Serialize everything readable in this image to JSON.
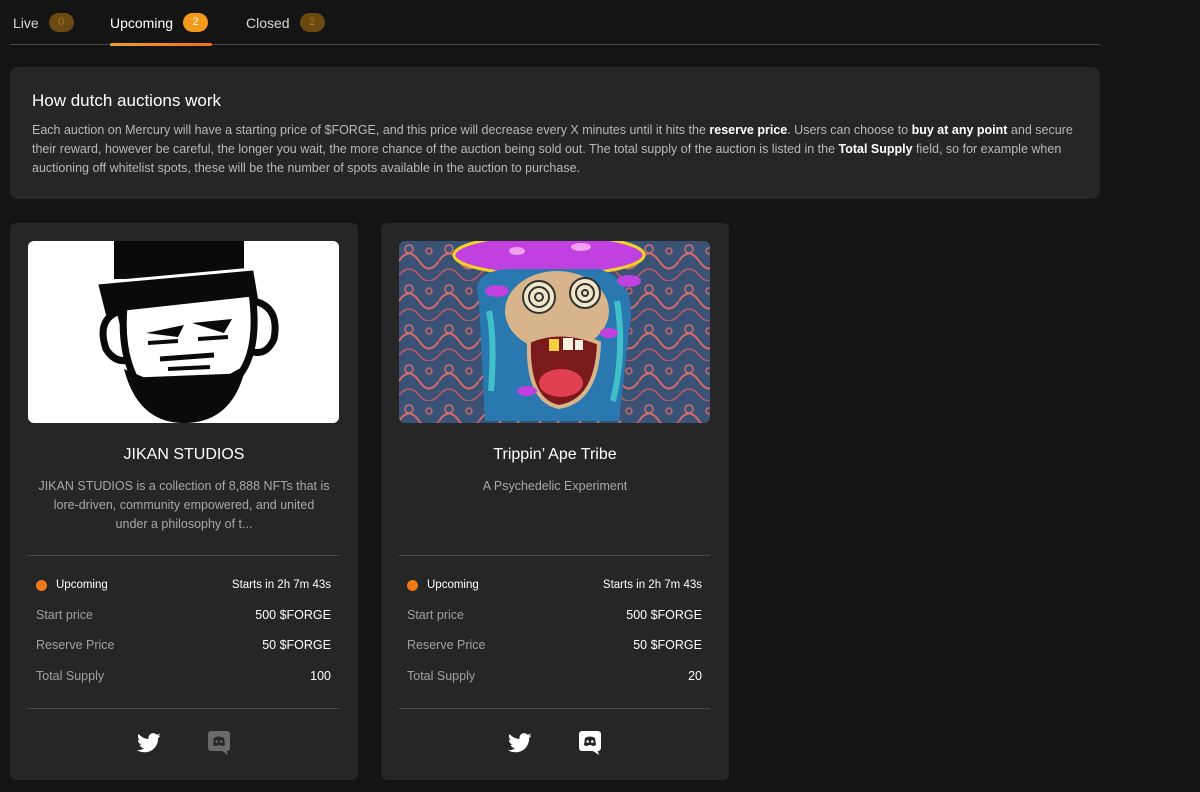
{
  "tabs": [
    {
      "label": "Live",
      "count": "0"
    },
    {
      "label": "Upcoming",
      "count": "2"
    },
    {
      "label": "Closed",
      "count": "2"
    }
  ],
  "info": {
    "title": "How dutch auctions work",
    "text_1": "Each auction on Mercury will have a starting price of $FORGE, and this price will decrease every X minutes until it hits the ",
    "bold_1": "reserve price",
    "text_2": ". Users can choose to ",
    "bold_2": "buy at any point",
    "text_3": " and secure their reward, however be careful, the longer you wait, the more chance of the auction being sold out. The total supply of the auction is listed in the ",
    "bold_3": "Total Supply",
    "text_4": " field, so for example when auctioning off whitelist spots, these will be the number of spots available in the auction to purchase."
  },
  "cards": [
    {
      "title": "JIKAN STUDIOS",
      "description": "JIKAN STUDIOS is a collection of 8,888 NFTs that is lore-driven, community empowered, and united under a philosophy of t...",
      "status": "Upcoming",
      "starts": "Starts in 2h 7m 43s",
      "start_price_label": "Start price",
      "start_price": "500 $FORGE",
      "reserve_label": "Reserve Price",
      "reserve_price": "50 $FORGE",
      "supply_label": "Total Supply",
      "supply": "100",
      "image_icon": "jikan-gentleman-ape-icon"
    },
    {
      "title": "Trippin’ Ape Tribe",
      "description": "A Psychedelic Experiment",
      "status": "Upcoming",
      "starts": "Starts in 2h 7m 43s",
      "start_price_label": "Start price",
      "start_price": "500 $FORGE",
      "reserve_label": "Reserve Price",
      "reserve_price": "50 $FORGE",
      "supply_label": "Total Supply",
      "supply": "20",
      "image_icon": "psychedelic-ape-icon"
    }
  ],
  "colors": {
    "background": "#141414",
    "card": "#262626",
    "accent": "#f39a1a",
    "status_dot": "#f07a18"
  }
}
